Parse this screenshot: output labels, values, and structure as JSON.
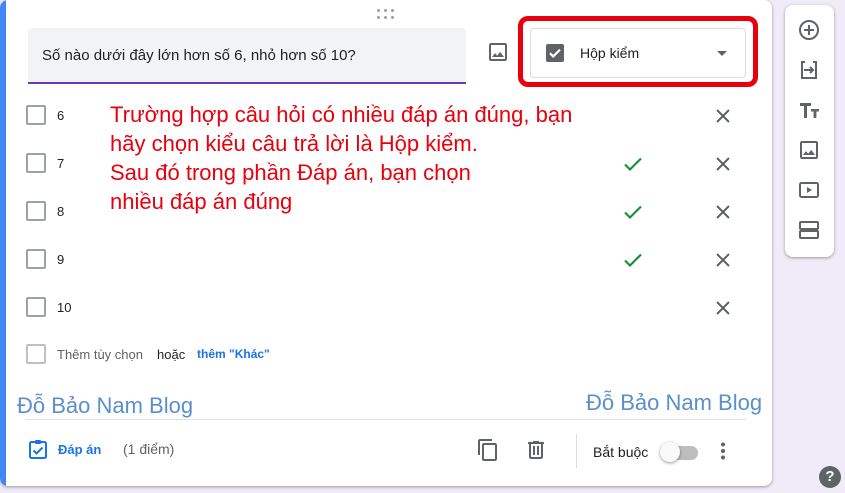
{
  "question": {
    "text": "Số nào dưới đây lớn hơn số 6, nhỏ hơn số 10?"
  },
  "type_select": {
    "label": "Hộp kiểm",
    "icon": "checkbox-icon"
  },
  "options": [
    {
      "label": "6",
      "correct": false
    },
    {
      "label": "7",
      "correct": true
    },
    {
      "label": "8",
      "correct": true
    },
    {
      "label": "9",
      "correct": true
    },
    {
      "label": "10",
      "correct": false
    }
  ],
  "add_option": {
    "add_text": "Thêm tùy chọn",
    "or_text": "hoặc",
    "other_link": "thêm \"Khác\""
  },
  "annotation": {
    "lines": [
      "Trường hợp câu hỏi có nhiều đáp án đúng, bạn",
      "hãy chọn kiểu câu trả lời là Hộp kiểm.",
      "Sau đó trong phần Đáp án, bạn chọn",
      "nhiều đáp án đúng"
    ]
  },
  "watermarks": {
    "left": "Đỗ Bảo Nam Blog",
    "right": "Đỗ Bảo Nam Blog"
  },
  "footer": {
    "answer_key_label": "Đáp án",
    "points_label": "(1 điểm)",
    "required_label": "Bắt buộc",
    "required_on": false
  },
  "side_toolbar": {
    "icons": [
      "add-question-icon",
      "import-questions-icon",
      "add-title-icon",
      "add-image-icon",
      "add-video-icon",
      "add-section-icon"
    ]
  },
  "help": {
    "glyph": "?"
  },
  "colors": {
    "accent": "#4285f4",
    "question_underline": "#673ab7",
    "check": "#1e8e3e",
    "highlight": "#e8000d",
    "annotation": "#e8000d",
    "link": "#1a73e8",
    "watermark": "#5b8fc9"
  }
}
